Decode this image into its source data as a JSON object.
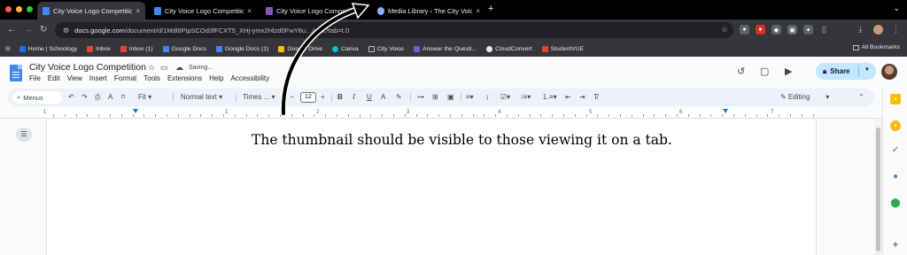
{
  "tabs": [
    {
      "title": "City Voice Logo Competition",
      "active": true,
      "favicon_color": "#4285f4"
    },
    {
      "title": "City Voice Logo Competition",
      "active": false,
      "favicon_color": "#4285f4"
    },
    {
      "title": "City Voice Logo Competition",
      "active": false,
      "favicon_color": "#7e57c2"
    },
    {
      "title": "Media Library ‹ The City Voice",
      "active": false,
      "favicon_color": "#8ab4f8"
    }
  ],
  "tab_close": "×",
  "new_tab": "+",
  "address": {
    "host": "docs.google.com",
    "path": "/document/d/1Mdl6PipSCOd3fFCXT5_XHj-ymx2Hlzd0FwY8u…/edit?tab=t.0"
  },
  "bookmarks": [
    {
      "label": "Home | Schoology",
      "color": "#1a73e8"
    },
    {
      "label": "Inbox",
      "color": "#ea4335"
    },
    {
      "label": "Inbox (1)",
      "color": "#ea4335"
    },
    {
      "label": "Google Docs",
      "color": "#4285f4"
    },
    {
      "label": "Google Docs (1)",
      "color": "#4285f4"
    },
    {
      "label": "Google Drive",
      "color": "#fbbc04"
    },
    {
      "label": "Canva",
      "color": "#00c4cc"
    },
    {
      "label": "City Voice",
      "color": "#9aa0a6"
    },
    {
      "label": "Answer the Questi...",
      "color": "#7e57c2"
    },
    {
      "label": "CloudConvert",
      "color": "#e8eaed"
    },
    {
      "label": "StudentVUE",
      "color": "#ea4335"
    }
  ],
  "all_bookmarks": "All Bookmarks",
  "doc": {
    "title": "City Voice Logo Competition",
    "saving": "Saving...",
    "menu": [
      "File",
      "Edit",
      "View",
      "Insert",
      "Format",
      "Tools",
      "Extensions",
      "Help",
      "Accessibility"
    ],
    "share_label": "Share",
    "body_text": "The thumbnail should be visible to those viewing it on a tab."
  },
  "toolbar": {
    "menus_label": "Menus",
    "zoom": "Fit",
    "style": "Normal text",
    "font": "Times ...",
    "font_size": "12",
    "mode": "Editing"
  },
  "ruler_numbers": [
    "1",
    "1",
    "2",
    "3",
    "4",
    "5",
    "6",
    "7"
  ],
  "colors": {
    "share_bg": "#c2e7ff",
    "accent": "#1a73e8",
    "arrow": "#000000"
  }
}
